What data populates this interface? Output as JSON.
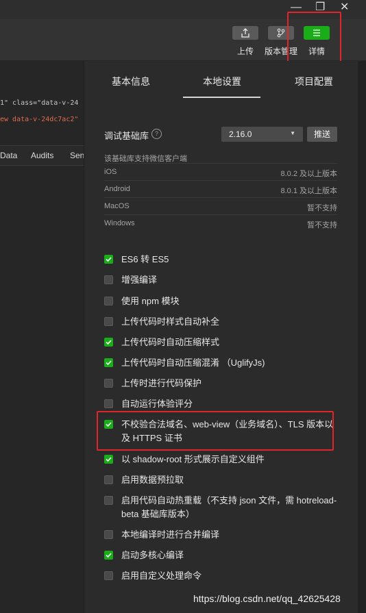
{
  "window": {
    "minimize_glyph": "—",
    "restore_glyph": "❐",
    "close_glyph": "✕"
  },
  "toolbar": {
    "upload_label": "上传",
    "version_label": "版本管理",
    "detail_label": "详情",
    "accent_color": "#1aad19"
  },
  "devtools": {
    "code_line_1": "1\" class=\"data-v-24",
    "code_line_2": "ew data-v-24dc7ac2\"",
    "tabs": [
      "Data",
      "Audits",
      "Sen"
    ]
  },
  "panel": {
    "tabs": [
      "基本信息",
      "本地设置",
      "项目配置"
    ],
    "active_tab": "本地设置",
    "lib_label": "调试基础库",
    "help_glyph": "?",
    "lib_version": "2.16.0",
    "push_label": "推送",
    "support_title": "该基础库支持微信客户端",
    "support_rows": [
      {
        "os": "iOS",
        "ver": "8.0.2 及以上版本"
      },
      {
        "os": "Android",
        "ver": "8.0.1 及以上版本"
      },
      {
        "os": "MacOS",
        "ver": "暂不支持"
      },
      {
        "os": "Windows",
        "ver": "暂不支持"
      }
    ],
    "options": [
      {
        "label": "ES6 转 ES5",
        "checked": true
      },
      {
        "label": "增强编译",
        "checked": false
      },
      {
        "label": "使用 npm 模块",
        "checked": false
      },
      {
        "label": "上传代码时样式自动补全",
        "checked": false
      },
      {
        "label": "上传代码时自动压缩样式",
        "checked": true
      },
      {
        "label": "上传代码时自动压缩混淆 （UglifyJs)",
        "checked": true
      },
      {
        "label": "上传时进行代码保护",
        "checked": false
      },
      {
        "label": "自动运行体验评分",
        "checked": false
      },
      {
        "label": "不校验合法域名、web-view（业务域名）、TLS 版本以及 HTTPS 证书",
        "checked": true
      },
      {
        "label": "以 shadow-root 形式展示自定义组件",
        "checked": true
      },
      {
        "label": "启用数据预拉取",
        "checked": false
      },
      {
        "label": "启用代码自动热重载（不支持 json 文件，需 hotreload-beta 基础库版本）",
        "checked": false
      },
      {
        "label": "本地编译时进行合并编译",
        "checked": false
      },
      {
        "label": "启动多核心编译",
        "checked": true
      },
      {
        "label": "启用自定义处理命令",
        "checked": false
      }
    ]
  },
  "watermark": "https://blog.csdn.net/qq_42625428"
}
